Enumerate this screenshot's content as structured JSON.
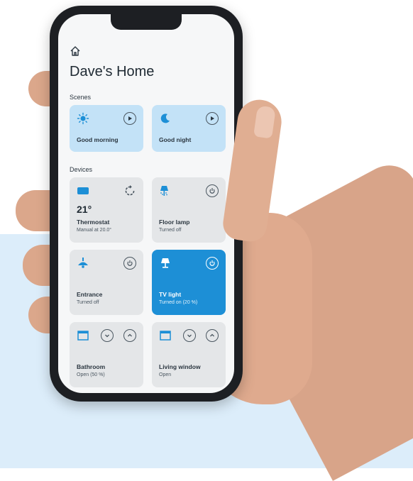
{
  "header": {
    "title": "Dave's Home"
  },
  "sections": {
    "scenes": "Scenes",
    "devices": "Devices"
  },
  "scenes": [
    {
      "name": "Good morning",
      "icon": "sun-icon"
    },
    {
      "name": "Good night",
      "icon": "moon-icon"
    }
  ],
  "devices": [
    {
      "name": "Thermostat",
      "value": "21°",
      "status": "Manual at 20.0°",
      "icon": "thermostat-icon",
      "active": false
    },
    {
      "name": "Floor lamp",
      "status": "Turned off",
      "icon": "floor-lamp-icon",
      "active": false
    },
    {
      "name": "Entrance",
      "status": "Turned off",
      "icon": "ceiling-light-icon",
      "active": false
    },
    {
      "name": "TV light",
      "status": "Turned on (20 %)",
      "icon": "lamp-icon",
      "active": true
    },
    {
      "name": "Bathroom",
      "status": "Open (50 %)",
      "icon": "window-blind-icon",
      "active": false
    },
    {
      "name": "Living window",
      "status": "Open",
      "icon": "window-blind-icon",
      "active": false
    }
  ],
  "colors": {
    "accent": "#1d8fd6",
    "scene_card": "#c3e2f7",
    "device_card": "#e4e6e8",
    "background_band": "#dcedfa"
  }
}
